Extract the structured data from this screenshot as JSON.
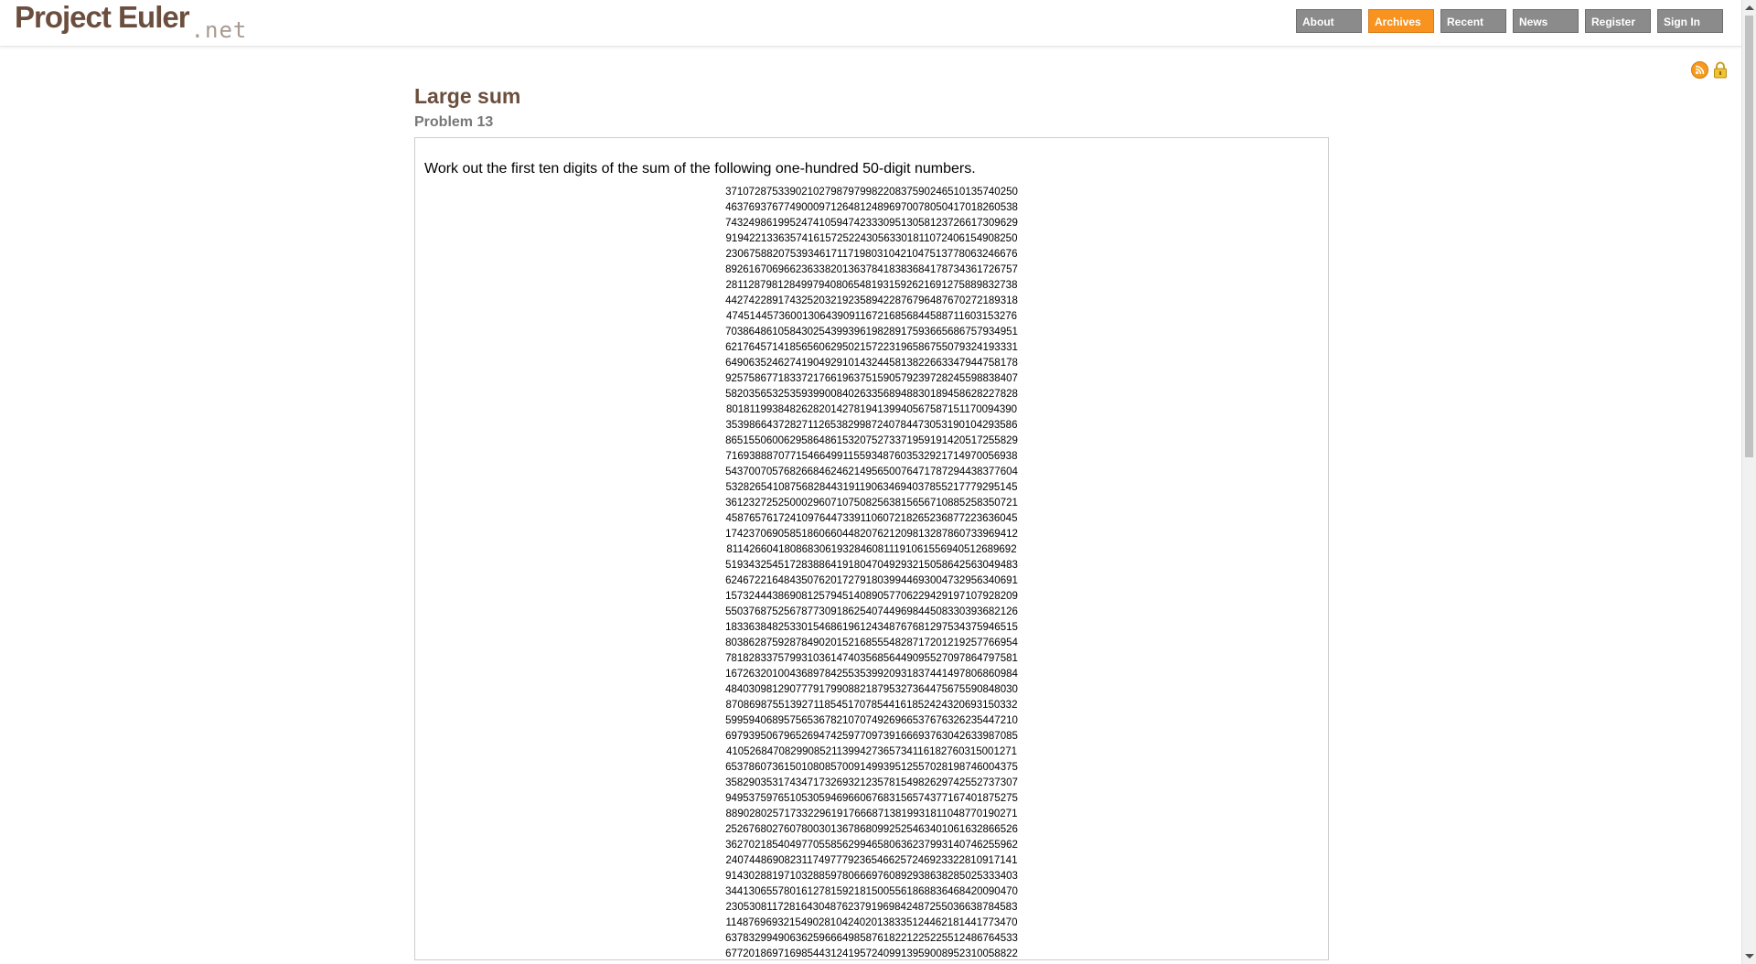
{
  "site": {
    "logo_main": "Project Euler",
    "logo_net": ".net"
  },
  "nav": {
    "items": [
      {
        "label": "About"
      },
      {
        "label": "Archives"
      },
      {
        "label": "Recent"
      },
      {
        "label": "News"
      },
      {
        "label": "Register"
      },
      {
        "label": "Sign In"
      }
    ],
    "active": "Archives"
  },
  "icons": {
    "rss": "rss-icon",
    "lock": "lock-icon"
  },
  "colors": {
    "brand": "#6b4e3d",
    "nav_default": "#8b8b8b",
    "nav_active": "#f7931e"
  },
  "problem": {
    "title": "Large sum",
    "number_label": "Problem 13",
    "description": "Work out the first ten digits of the sum of the following one-hundred 50-digit numbers.",
    "numbers": [
      "37107287533902102798797998220837590246510135740250",
      "46376937677490009712648124896970078050417018260538",
      "74324986199524741059474233309513058123726617309629",
      "91942213363574161572522430563301811072406154908250",
      "23067588207539346171171980310421047513778063246676",
      "89261670696623633820136378418383684178734361726757",
      "28112879812849979408065481931592621691275889832738",
      "44274228917432520321923589422876796487670272189318",
      "47451445736001306439091167216856844588711603153276",
      "70386486105843025439939619828917593665686757934951",
      "62176457141856560629502157223196586755079324193331",
      "64906352462741904929101432445813822663347944758178",
      "92575867718337217661963751590579239728245598838407",
      "58203565325359399008402633568948830189458628227828",
      "80181199384826282014278194139940567587151170094390",
      "35398664372827112653829987240784473053190104293586",
      "86515506006295864861532075273371959191420517255829",
      "71693888707715466499115593487603532921714970056938",
      "54370070576826684624621495650076471787294438377604",
      "53282654108756828443191190634694037855217779295145",
      "36123272525000296071075082563815656710885258350721",
      "45876576172410976447339110607218265236877223636045",
      "17423706905851860660448207621209813287860733969412",
      "81142660418086830619328460811191061556940512689692",
      "51934325451728388641918047049293215058642563049483",
      "62467221648435076201727918039944693004732956340691",
      "15732444386908125794514089057706229429197107928209",
      "55037687525678773091862540744969844508330393682126",
      "18336384825330154686196124348767681297534375946515",
      "80386287592878490201521685554828717201219257766954",
      "78182833757993103614740356856449095527097864797581",
      "16726320100436897842553539920931837441497806860984",
      "48403098129077791799088218795327364475675590848030",
      "87086987551392711854517078544161852424320693150332",
      "59959406895756536782107074926966537676326235447210",
      "69793950679652694742597709739166693763042633987085",
      "41052684708299085211399427365734116182760315001271",
      "65378607361501080857009149939512557028198746004375",
      "35829035317434717326932123578154982629742552737307",
      "94953759765105305946966067683156574377167401875275",
      "88902802571733229619176668713819931811048770190271",
      "25267680276078003013678680992525463401061632866526",
      "36270218540497705585629946580636237993140746255962",
      "24074486908231174977792365466257246923322810917141",
      "91430288197103288597806669760892938638285025333403",
      "34413065578016127815921815005561868836468420090470",
      "23053081172816430487623791969842487255036638784583",
      "11487696932154902810424020138335124462181441773470",
      "63783299490636259666498587618221225225512486764533",
      "67720186971698544312419572409913959008952310058822"
    ]
  }
}
